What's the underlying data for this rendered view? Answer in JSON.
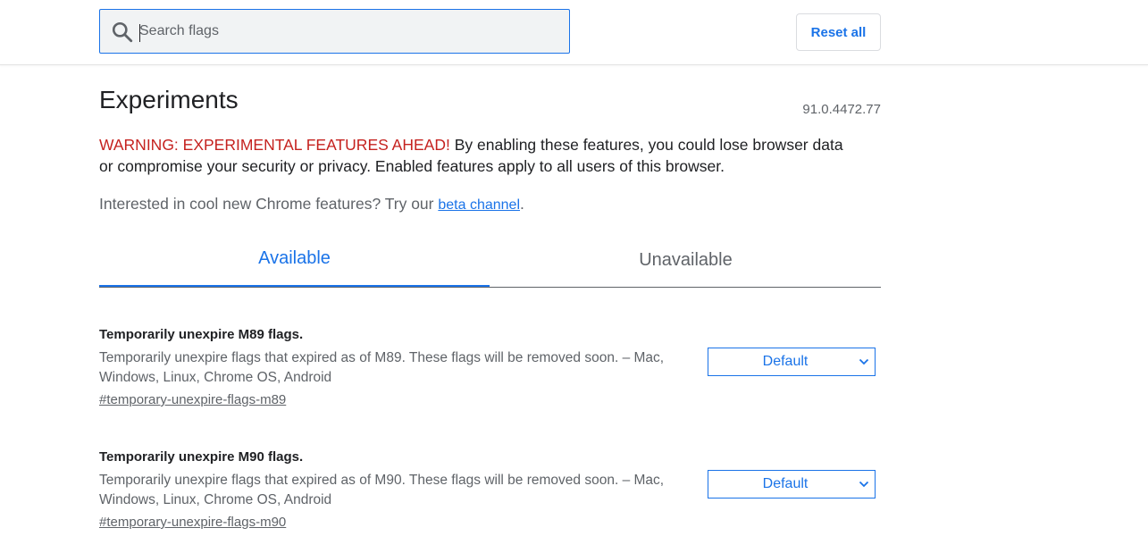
{
  "search": {
    "placeholder": "Search flags",
    "value": ""
  },
  "toolbar": {
    "reset_label": "Reset all"
  },
  "page": {
    "title": "Experiments",
    "version": "91.0.4472.77",
    "warning_prefix": "WARNING: EXPERIMENTAL FEATURES AHEAD!",
    "warning_text": " By enabling these features, you could lose browser data or compromise your security or privacy. Enabled features apply to all users of this browser.",
    "interested_text": "Interested in cool new Chrome features? Try our ",
    "beta_link": "beta channel",
    "interested_suffix": "."
  },
  "tabs": [
    {
      "label": "Available",
      "active": true
    },
    {
      "label": "Unavailable",
      "active": false
    }
  ],
  "flags": [
    {
      "name": "Temporarily unexpire M89 flags.",
      "description": "Temporarily unexpire flags that expired as of M89. These flags will be removed soon. – Mac, Windows, Linux, Chrome OS, Android",
      "link": "#temporary-unexpire-flags-m89",
      "selected": "Default"
    },
    {
      "name": "Temporarily unexpire M90 flags.",
      "description": "Temporarily unexpire flags that expired as of M90. These flags will be removed soon. – Mac, Windows, Linux, Chrome OS, Android",
      "link": "#temporary-unexpire-flags-m90",
      "selected": "Default"
    }
  ],
  "colors": {
    "accent": "#1a73e8",
    "warning": "#c5221f",
    "secondary_text": "#5f6368"
  },
  "icons": {
    "search": "search-icon",
    "dropdown": "chevron-down-icon"
  }
}
